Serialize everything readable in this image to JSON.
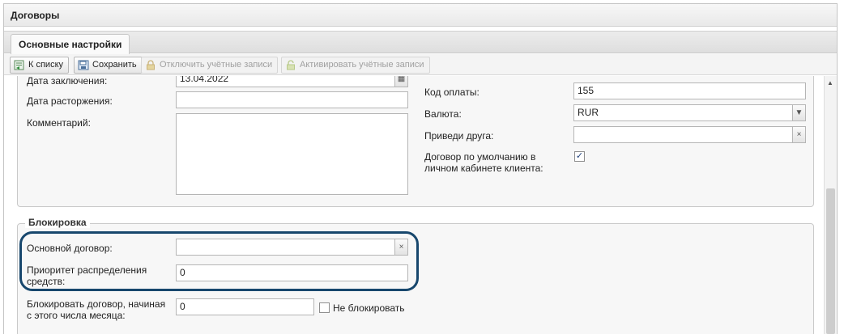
{
  "window": {
    "title": "Договоры"
  },
  "tabs": [
    {
      "label": "Основные настройки"
    }
  ],
  "toolbar": {
    "to_list": "К списку",
    "save": "Сохранить",
    "disable_accounts": "Отключить учётные записи",
    "activate_accounts": "Активировать учётные записи"
  },
  "form": {
    "left": {
      "conclusion_date_label": "Дата заключения:",
      "conclusion_date_value": "13.04.2022",
      "termination_date_label": "Дата расторжения:",
      "termination_date_value": "",
      "comment_label": "Комментарий:",
      "comment_value": ""
    },
    "right": {
      "payment_code_label": "Код оплаты:",
      "payment_code_value": "155",
      "currency_label": "Валюта:",
      "currency_value": "RUR",
      "referral_label": "Приведи друга:",
      "referral_value": "",
      "default_contract_label_line1": "Договор по умолчанию в",
      "default_contract_label_line2": "личном кабинете клиента:",
      "default_contract_checked": true
    }
  },
  "blocking": {
    "legend": "Блокировка",
    "main_contract_label": "Основной договор:",
    "main_contract_value": "",
    "priority_label_line1": "Приоритет распределения",
    "priority_label_line2": "средств:",
    "priority_value": "0",
    "block_from_label_line1": "Блокировать договор, начиная",
    "block_from_label_line2": "с этого числа месяца:",
    "block_from_value": "0",
    "no_block_label": "Не блокировать",
    "no_block_checked": false
  },
  "icons": {
    "check_mark": "✓",
    "clear": "×",
    "dropdown": "▼",
    "calendar": "▦",
    "scroll_up": "▲"
  },
  "colors": {
    "highlight": "#17476d"
  }
}
